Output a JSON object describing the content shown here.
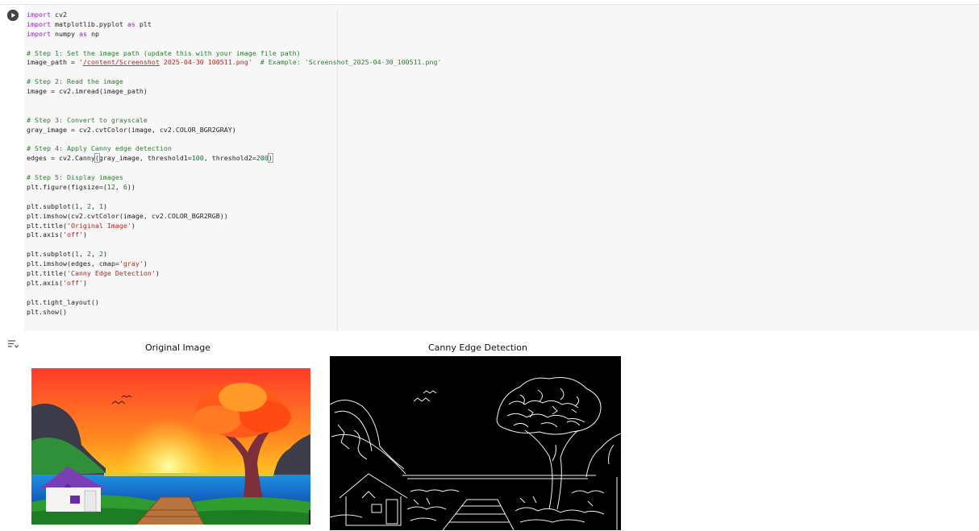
{
  "notebook": {
    "code_lines": [
      [
        {
          "t": "import",
          "c": "kw"
        },
        {
          "t": " cv2"
        }
      ],
      [
        {
          "t": "import",
          "c": "kw"
        },
        {
          "t": " matplotlib.pyplot "
        },
        {
          "t": "as",
          "c": "kw"
        },
        {
          "t": " plt"
        }
      ],
      [
        {
          "t": "import",
          "c": "kw"
        },
        {
          "t": " numpy "
        },
        {
          "t": "as",
          "c": "kw"
        },
        {
          "t": " np"
        }
      ],
      [],
      [
        {
          "t": "# Step 1: Set the image path (update this with your image file path)",
          "c": "cm"
        }
      ],
      [
        {
          "t": "image_path = "
        },
        {
          "t": "'",
          "c": "st"
        },
        {
          "t": "/content/Screenshot",
          "c": "st squiggle"
        },
        {
          "t": " 2025-04-30 100511.png'",
          "c": "st"
        },
        {
          "t": "  "
        },
        {
          "t": "# Example: 'Screenshot_2025-04-30_100511.png'",
          "c": "cm"
        }
      ],
      [],
      [
        {
          "t": "# Step 2: Read the image",
          "c": "cm"
        }
      ],
      [
        {
          "t": "image = cv2.imread(image_path)"
        }
      ],
      [],
      [],
      [
        {
          "t": "# Step 3: Convert to grayscale",
          "c": "cm"
        }
      ],
      [
        {
          "t": "gray_image = cv2.cvtColor(image, cv2.COLOR_BGR2GRAY)"
        }
      ],
      [],
      [
        {
          "t": "# Step 4: Apply Canny edge detection",
          "c": "cm"
        }
      ],
      [
        {
          "t": "edges = cv2.Canny"
        },
        {
          "t": "(",
          "c": "bracket"
        },
        {
          "t": "gray_image, threshold1="
        },
        {
          "t": "100",
          "c": "nm"
        },
        {
          "t": ", threshold2="
        },
        {
          "t": "200",
          "c": "nm"
        },
        {
          "t": ")",
          "c": "bracket"
        }
      ],
      [],
      [
        {
          "t": "# Step 5: Display images",
          "c": "cm"
        }
      ],
      [
        {
          "t": "plt.figure(figsize=("
        },
        {
          "t": "12",
          "c": "nm"
        },
        {
          "t": ", "
        },
        {
          "t": "6",
          "c": "nm"
        },
        {
          "t": "))"
        }
      ],
      [],
      [
        {
          "t": "plt.subplot("
        },
        {
          "t": "1",
          "c": "nm"
        },
        {
          "t": ", "
        },
        {
          "t": "2",
          "c": "nm"
        },
        {
          "t": ", "
        },
        {
          "t": "1",
          "c": "nm"
        },
        {
          "t": ")"
        }
      ],
      [
        {
          "t": "plt.imshow(cv2.cvtColor(image, cv2.COLOR_BGR2RGB))"
        }
      ],
      [
        {
          "t": "plt.title("
        },
        {
          "t": "'Original Image'",
          "c": "st"
        },
        {
          "t": ")"
        }
      ],
      [
        {
          "t": "plt.axis("
        },
        {
          "t": "'off'",
          "c": "st"
        },
        {
          "t": ")"
        }
      ],
      [],
      [
        {
          "t": "plt.subplot("
        },
        {
          "t": "1",
          "c": "nm"
        },
        {
          "t": ", "
        },
        {
          "t": "2",
          "c": "nm"
        },
        {
          "t": ", "
        },
        {
          "t": "2",
          "c": "nm"
        },
        {
          "t": ")"
        }
      ],
      [
        {
          "t": "plt.imshow(edges, cmap="
        },
        {
          "t": "'gray'",
          "c": "st"
        },
        {
          "t": ")"
        }
      ],
      [
        {
          "t": "plt.title("
        },
        {
          "t": "'Canny Edge Detection'",
          "c": "st"
        },
        {
          "t": ")"
        }
      ],
      [
        {
          "t": "plt.axis("
        },
        {
          "t": "'off'",
          "c": "st"
        },
        {
          "t": ")"
        }
      ],
      [],
      [
        {
          "t": "plt.tight_layout()"
        }
      ],
      [
        {
          "t": "plt.show()"
        }
      ]
    ]
  },
  "output": {
    "left_title": "Original Image",
    "right_title": "Canny Edge Detection"
  },
  "icons": {
    "run": "play-circle-icon",
    "output_toggle": "output-toggle-icon"
  },
  "colors": {
    "editor_bg": "#f7f7f7",
    "keyword": "#8e2bbf",
    "comment": "#2e7d32",
    "string": "#b3261e"
  }
}
